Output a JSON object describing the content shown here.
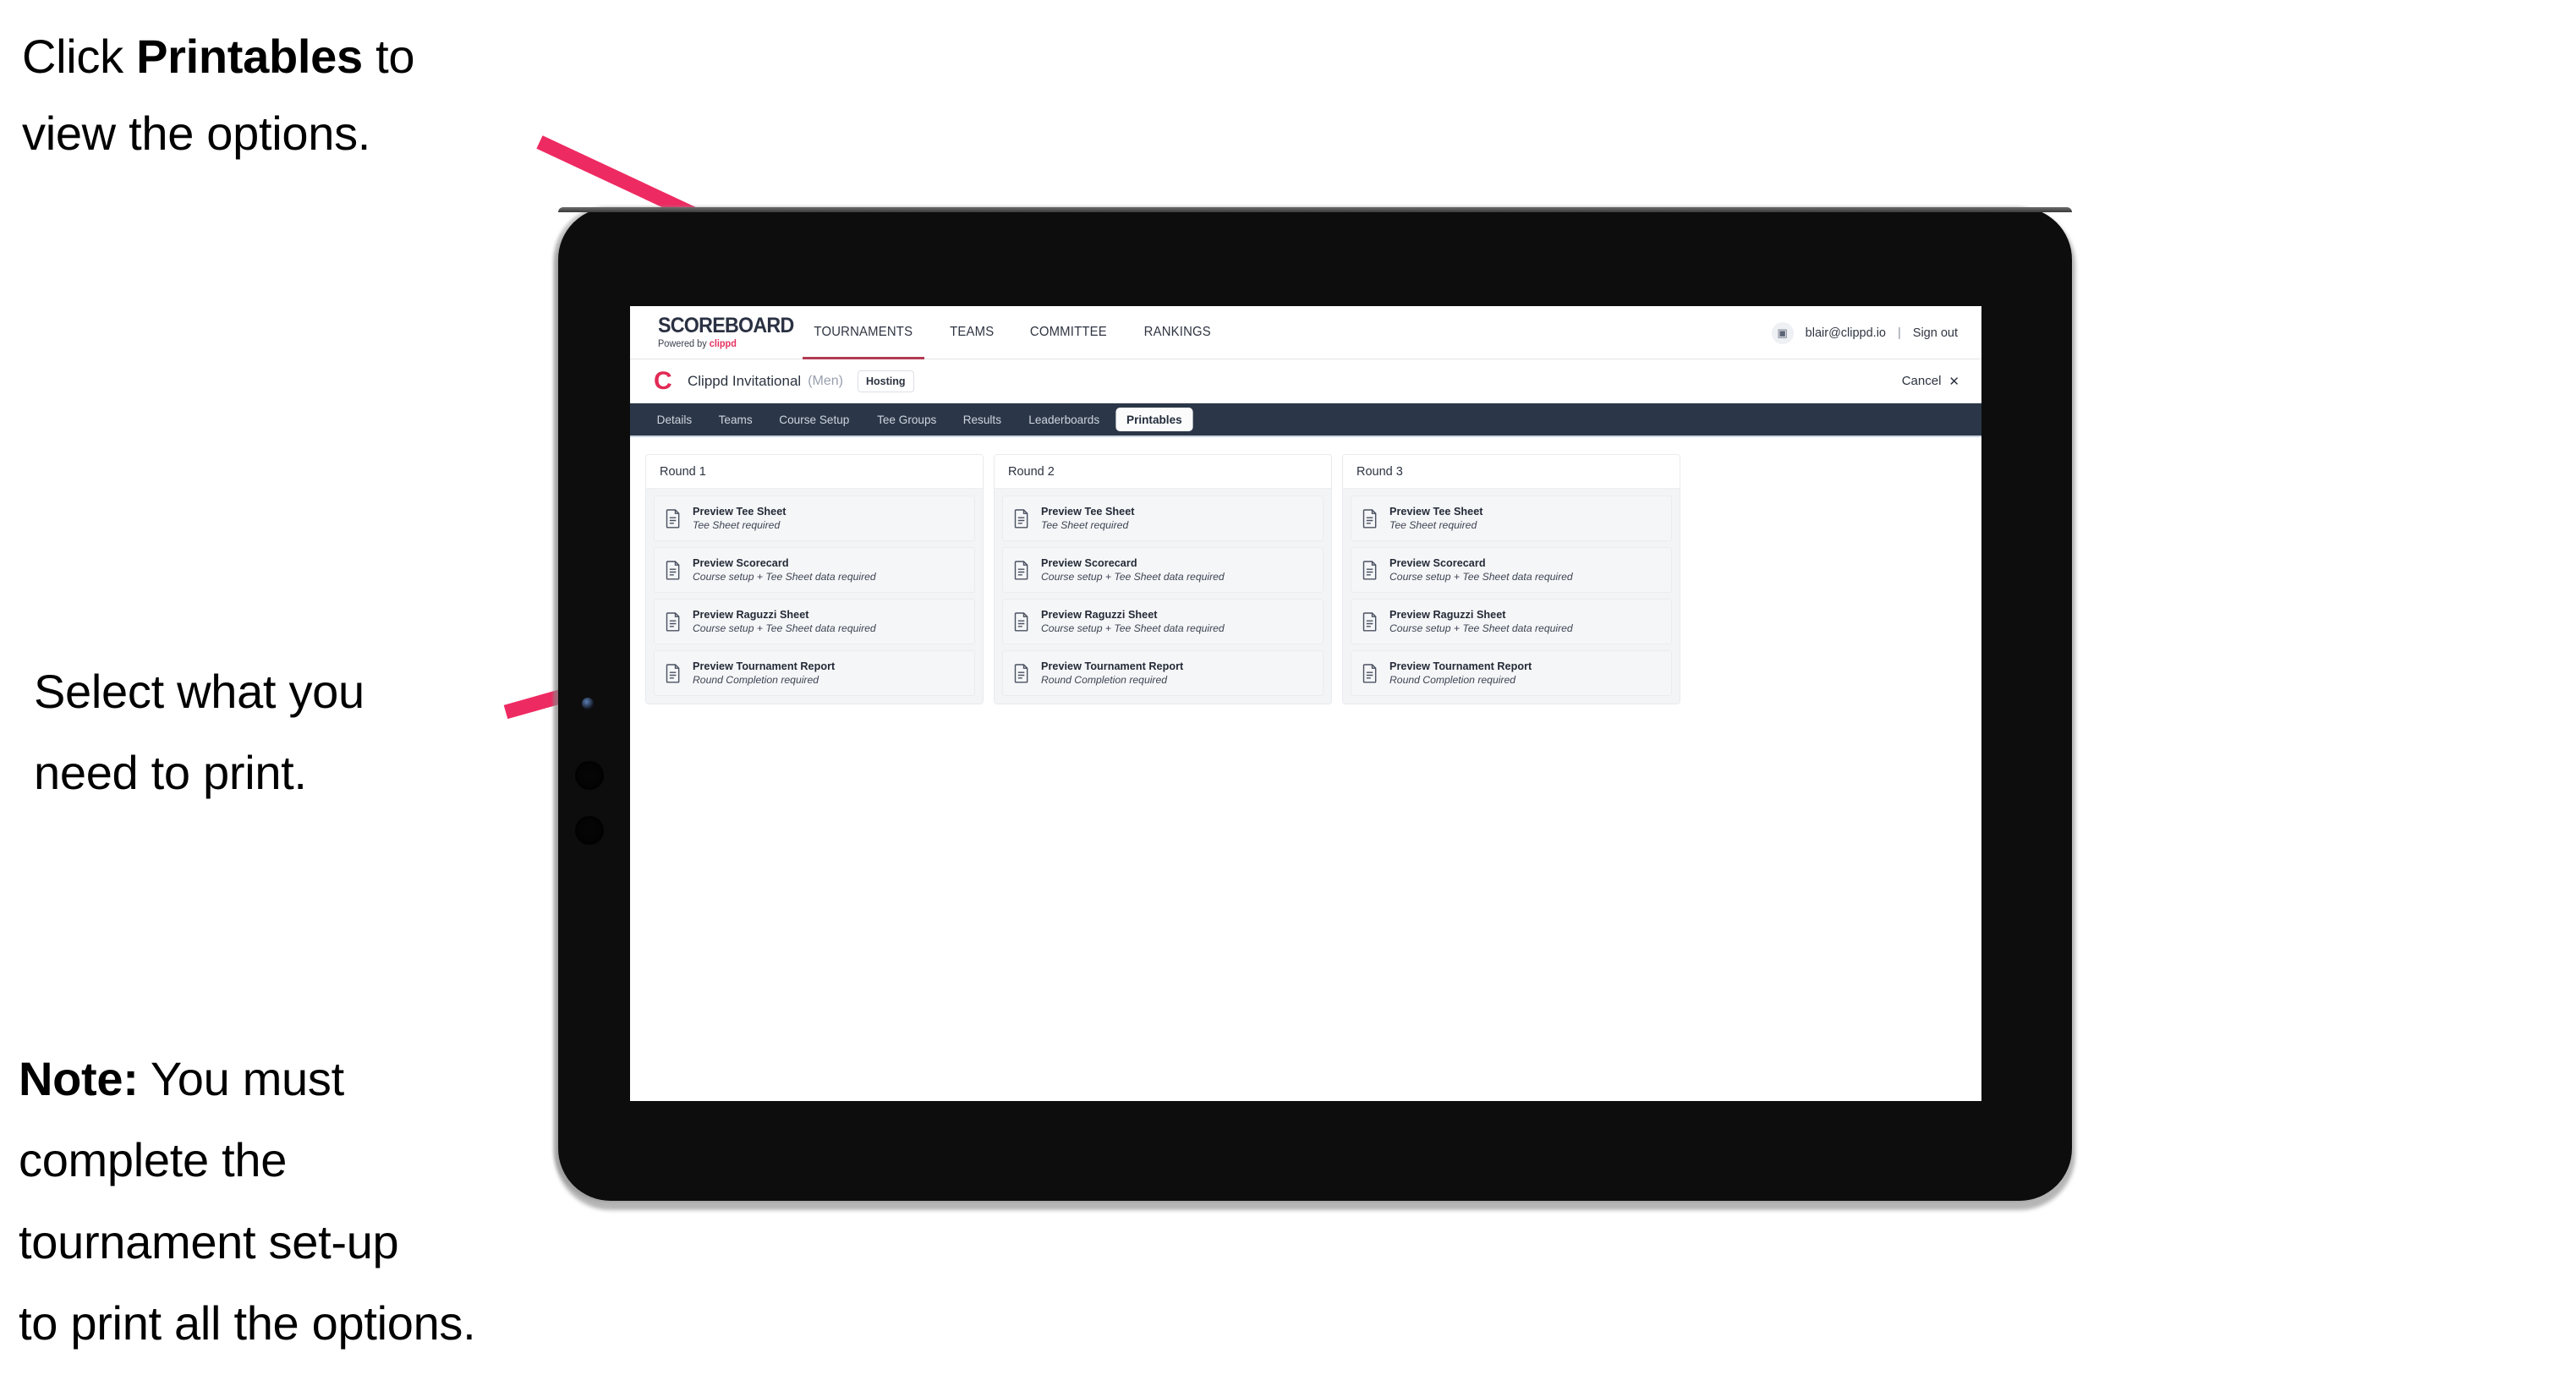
{
  "annotations": [
    {
      "id": "annot-1",
      "segments": [
        {
          "text": "Click ",
          "bold": false
        },
        {
          "text": "Printables",
          "bold": true
        },
        {
          "text": " to",
          "bold": false
        },
        {
          "text": "\n",
          "bold": false
        },
        {
          "text": "view the options.",
          "bold": false
        }
      ]
    },
    {
      "id": "annot-2",
      "segments": [
        {
          "text": "Select what you",
          "bold": false
        },
        {
          "text": "\n",
          "bold": false
        },
        {
          "text": " need to print.",
          "bold": false
        }
      ]
    },
    {
      "id": "annot-3",
      "segments": [
        {
          "text": "Note:",
          "bold": true
        },
        {
          "text": " You must",
          "bold": false
        },
        {
          "text": "\n",
          "bold": false
        },
        {
          "text": "complete the",
          "bold": false
        },
        {
          "text": "\n",
          "bold": false
        },
        {
          "text": "tournament set-up",
          "bold": false
        },
        {
          "text": "\n",
          "bold": false
        },
        {
          "text": "to print all the options.",
          "bold": false
        }
      ]
    }
  ],
  "colors": {
    "arrow": "#ee2a62",
    "navbar": "#2b3748",
    "brand_pink": "#e53060",
    "tournament_logo": "#e12a55",
    "tab_active_bg": "#fbfbfc",
    "card_bg": "#f5f6f8",
    "panel_bg": "#f3f4f6"
  },
  "brandbar": {
    "logo_word": "SCOREBOARD",
    "logo_sub_prefix": "Powered by ",
    "logo_sub_brand": "clippd",
    "nav": [
      {
        "label": "TOURNAMENTS",
        "active": true
      },
      {
        "label": "TEAMS",
        "active": false
      },
      {
        "label": "COMMITTEE",
        "active": false
      },
      {
        "label": "RANKINGS",
        "active": false
      }
    ],
    "account": {
      "avatar_glyph": "▣",
      "email": "blair@clippd.io",
      "separator": "|",
      "sign_out": "Sign out"
    }
  },
  "tournament_bar": {
    "logo_letter": "C",
    "title": "Clippd Invitational",
    "gender": "(Men)",
    "badge": "Hosting",
    "cancel_label": "Cancel",
    "cancel_icon": "✕"
  },
  "tabs": [
    {
      "label": "Details",
      "active": false
    },
    {
      "label": "Teams",
      "active": false
    },
    {
      "label": "Course Setup",
      "active": false
    },
    {
      "label": "Tee Groups",
      "active": false
    },
    {
      "label": "Results",
      "active": false
    },
    {
      "label": "Leaderboards",
      "active": false
    },
    {
      "label": "Printables",
      "active": true
    }
  ],
  "rounds": [
    {
      "title": "Round 1",
      "items": [
        {
          "title": "Preview Tee Sheet",
          "subtitle": "Tee Sheet required"
        },
        {
          "title": "Preview Scorecard",
          "subtitle": "Course setup + Tee Sheet data required"
        },
        {
          "title": "Preview Raguzzi Sheet",
          "subtitle": "Course setup + Tee Sheet data required"
        },
        {
          "title": "Preview Tournament Report",
          "subtitle": "Round Completion required"
        }
      ]
    },
    {
      "title": "Round 2",
      "items": [
        {
          "title": "Preview Tee Sheet",
          "subtitle": "Tee Sheet required"
        },
        {
          "title": "Preview Scorecard",
          "subtitle": "Course setup + Tee Sheet data required"
        },
        {
          "title": "Preview Raguzzi Sheet",
          "subtitle": "Course setup + Tee Sheet data required"
        },
        {
          "title": "Preview Tournament Report",
          "subtitle": "Round Completion required"
        }
      ]
    },
    {
      "title": "Round 3",
      "items": [
        {
          "title": "Preview Tee Sheet",
          "subtitle": "Tee Sheet required"
        },
        {
          "title": "Preview Scorecard",
          "subtitle": "Course setup + Tee Sheet data required"
        },
        {
          "title": "Preview Raguzzi Sheet",
          "subtitle": "Course setup + Tee Sheet data required"
        },
        {
          "title": "Preview Tournament Report",
          "subtitle": "Round Completion required"
        }
      ]
    }
  ]
}
